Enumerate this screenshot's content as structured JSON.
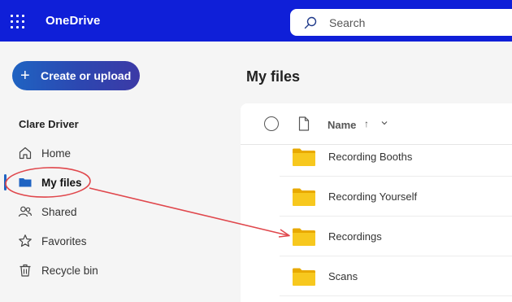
{
  "app": {
    "title": "OneDrive"
  },
  "search": {
    "placeholder": "Search"
  },
  "sidebar": {
    "create_label": "Create or upload",
    "user_name": "Clare Driver",
    "items": [
      {
        "label": "Home",
        "icon": "home-icon"
      },
      {
        "label": "My files",
        "icon": "folder-icon",
        "active": true
      },
      {
        "label": "Shared",
        "icon": "people-icon"
      },
      {
        "label": "Favorites",
        "icon": "star-icon"
      },
      {
        "label": "Recycle bin",
        "icon": "trash-icon"
      }
    ]
  },
  "main": {
    "title": "My files",
    "column_name": "Name",
    "sort_indicator": "↑",
    "files": [
      {
        "name": "Recording Booths",
        "type": "folder"
      },
      {
        "name": "Recording Yourself",
        "type": "folder"
      },
      {
        "name": "Recordings",
        "type": "folder"
      },
      {
        "name": "Scans",
        "type": "folder"
      }
    ]
  },
  "annotation": {
    "color": "#e0474c"
  },
  "colors": {
    "topbar": "#0f1fd8",
    "accent": "#1f63c2",
    "folder": "#f5c518"
  }
}
